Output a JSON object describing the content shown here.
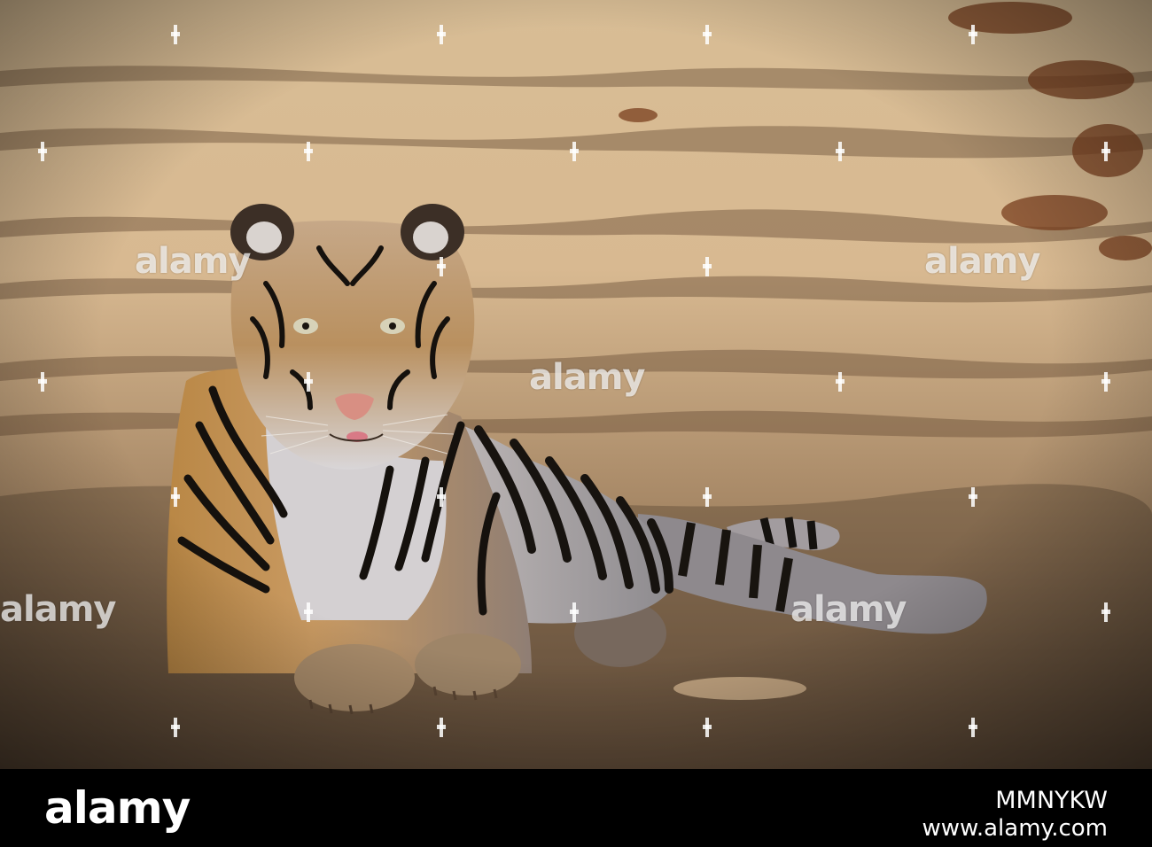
{
  "watermark": {
    "word": "alamy"
  },
  "footer": {
    "logo": "alamy",
    "image_id": "MMNYKW",
    "url": "www.alamy.com"
  }
}
